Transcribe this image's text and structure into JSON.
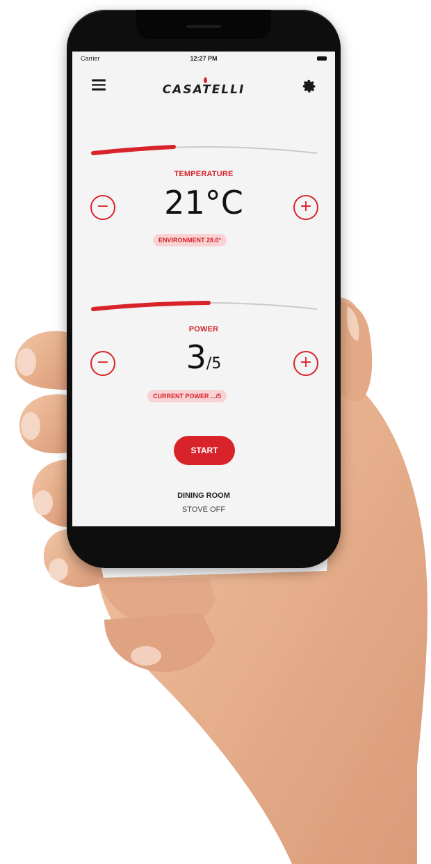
{
  "status_bar": {
    "carrier": "Carrier",
    "time": "12:27 PM"
  },
  "header": {
    "brand": "CASATELLI",
    "menu_icon": "hamburger-menu-icon",
    "settings_icon": "gear-icon"
  },
  "temperature": {
    "label": "TEMPERATURE",
    "value": "21°C",
    "environment": "ENVIRONMENT 28.0°",
    "slider_level": 0.38
  },
  "power": {
    "label": "POWER",
    "value": "3",
    "max": "/5",
    "current": "CURRENT POWER .../5",
    "slider_level": 0.52
  },
  "controls": {
    "minus": "−",
    "plus": "+",
    "start": "START"
  },
  "room": {
    "name": "DINING ROOM",
    "status": "STOVE OFF"
  },
  "colors": {
    "accent": "#d8232a",
    "pill_bg": "#f7d3d4",
    "screen_bg": "#f4f4f4",
    "phone": "#0e0e0e"
  }
}
